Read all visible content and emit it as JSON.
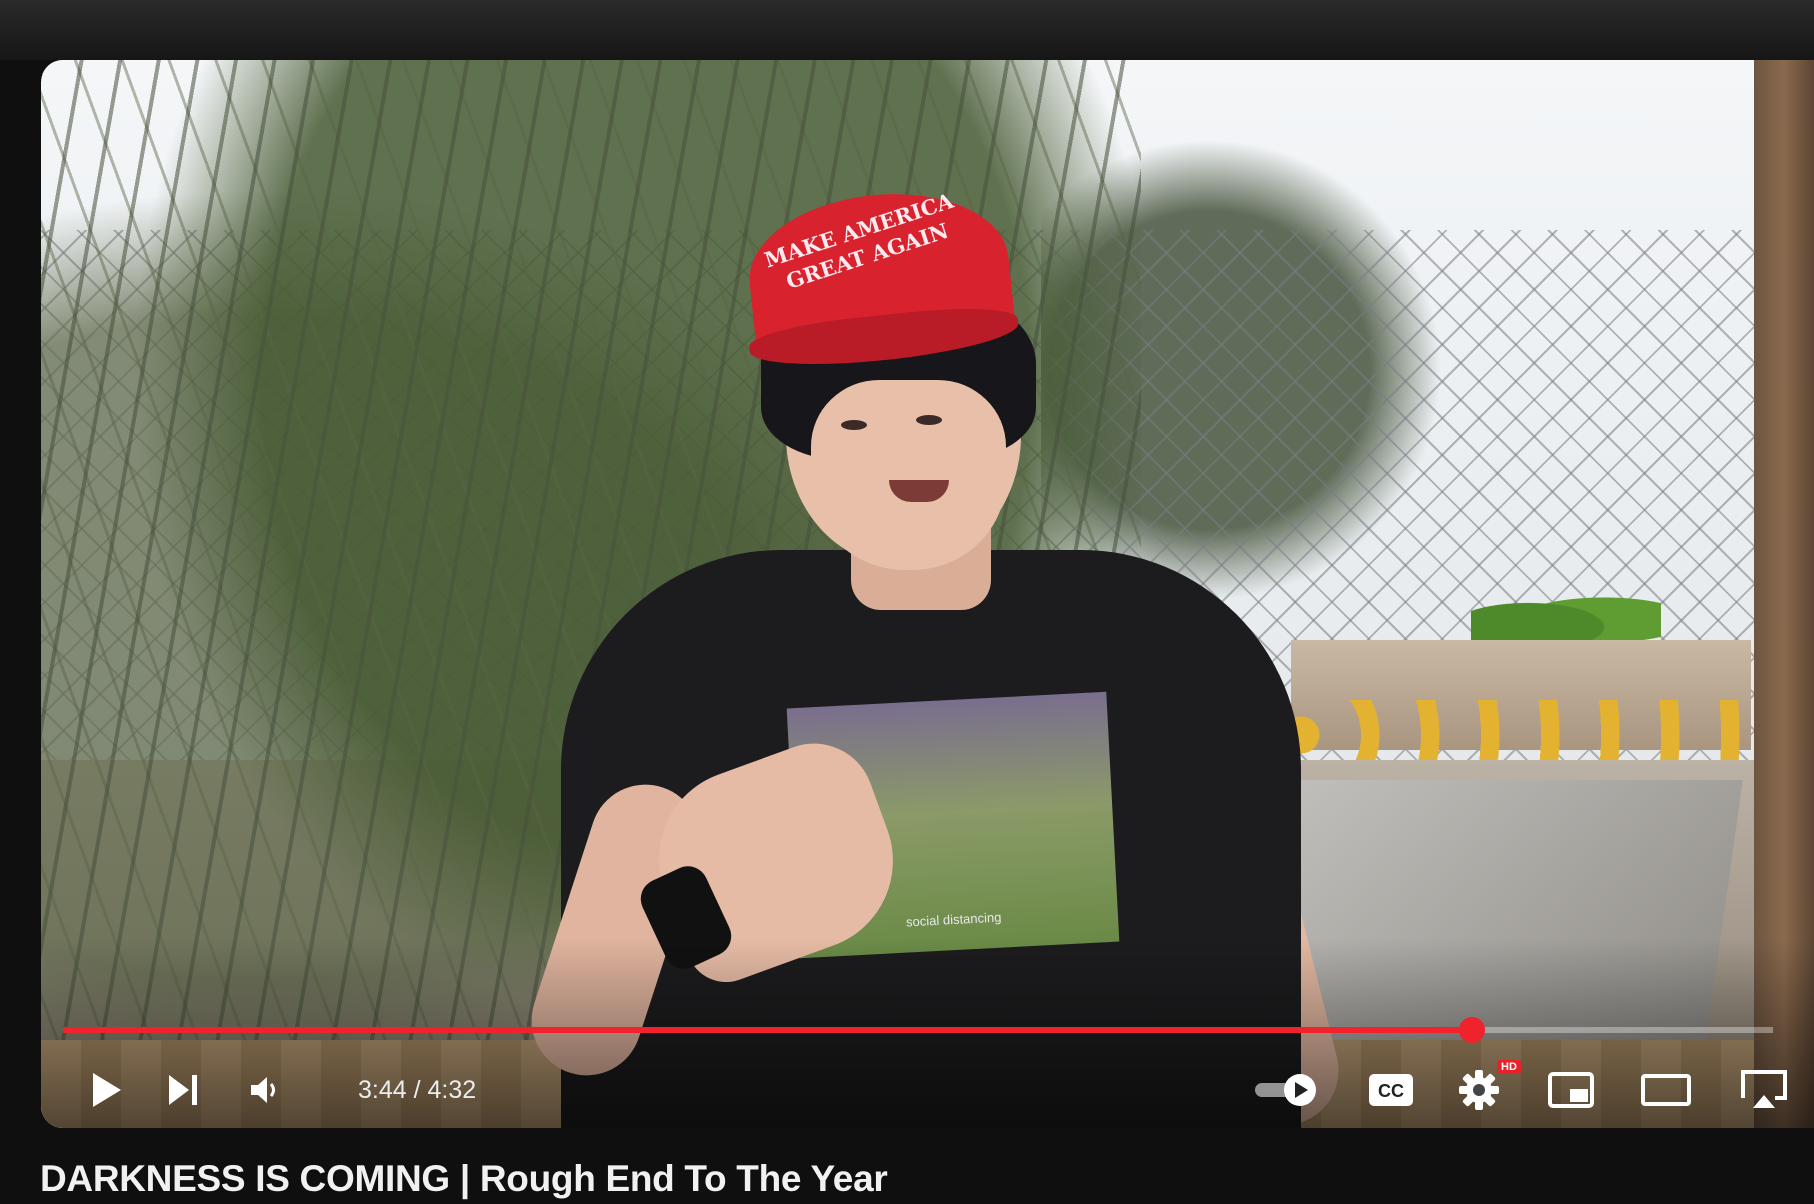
{
  "player": {
    "current_time": "3:44",
    "separator": " / ",
    "duration": "4:32",
    "progress_fraction": 0.824,
    "quality_badge": "HD",
    "accent_color": "#f0222c",
    "controls": {
      "play": "play-icon",
      "next": "next-icon",
      "volume": "volume-icon",
      "autoplay": "autoplay-toggle-icon",
      "captions": "CC",
      "settings": "gear-icon",
      "miniplayer": "miniplayer-icon",
      "theater": "theater-icon",
      "cast": "cast-icon"
    }
  },
  "video_frame": {
    "cap_text": "MAKE AMERICA GREAT AGAIN",
    "shirt_text": "social distancing"
  },
  "video": {
    "title": "DARKNESS IS COMING | Rough End To The Year"
  }
}
